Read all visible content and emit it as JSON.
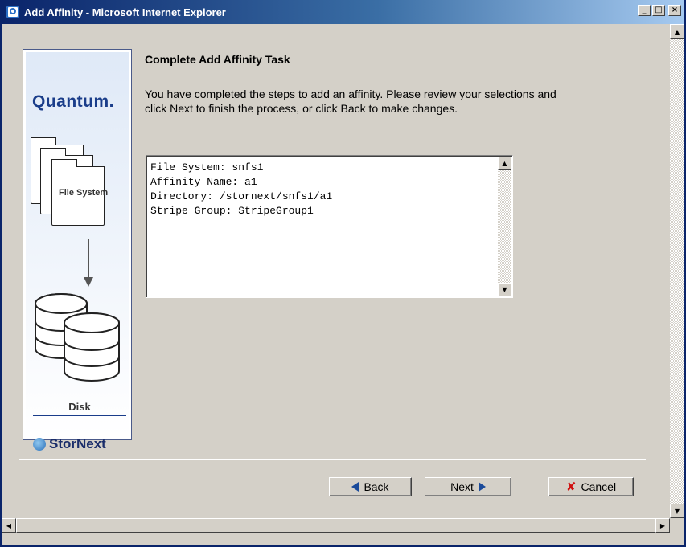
{
  "window": {
    "title": "Add Affinity - Microsoft Internet Explorer",
    "minimize_label": "_",
    "maximize_label": "□",
    "close_label": "×"
  },
  "sidebar": {
    "logo_top": "Quantum.",
    "file_system_label": "File System",
    "disk_label": "Disk",
    "logo_bottom": "StorNext"
  },
  "main": {
    "title": "Complete Add Affinity Task",
    "description": "You have completed the steps to add an affinity. Please review your selections and click Next to finish the process, or click Back to make changes.",
    "summary_lines": [
      "File System: snfs1",
      "Affinity Name: a1",
      "Directory: /stornext/snfs1/a1",
      "Stripe Group: StripeGroup1"
    ]
  },
  "buttons": {
    "back": "Back",
    "next": "Next",
    "cancel": "Cancel"
  },
  "icons": {
    "app": "ie-icon",
    "back": "left-arrow-icon",
    "next": "right-arrow-icon",
    "cancel": "x-icon"
  },
  "colors": {
    "titlebar_start": "#0a246a",
    "brand_blue": "#1a3d8a",
    "cancel_red": "#d01010"
  }
}
